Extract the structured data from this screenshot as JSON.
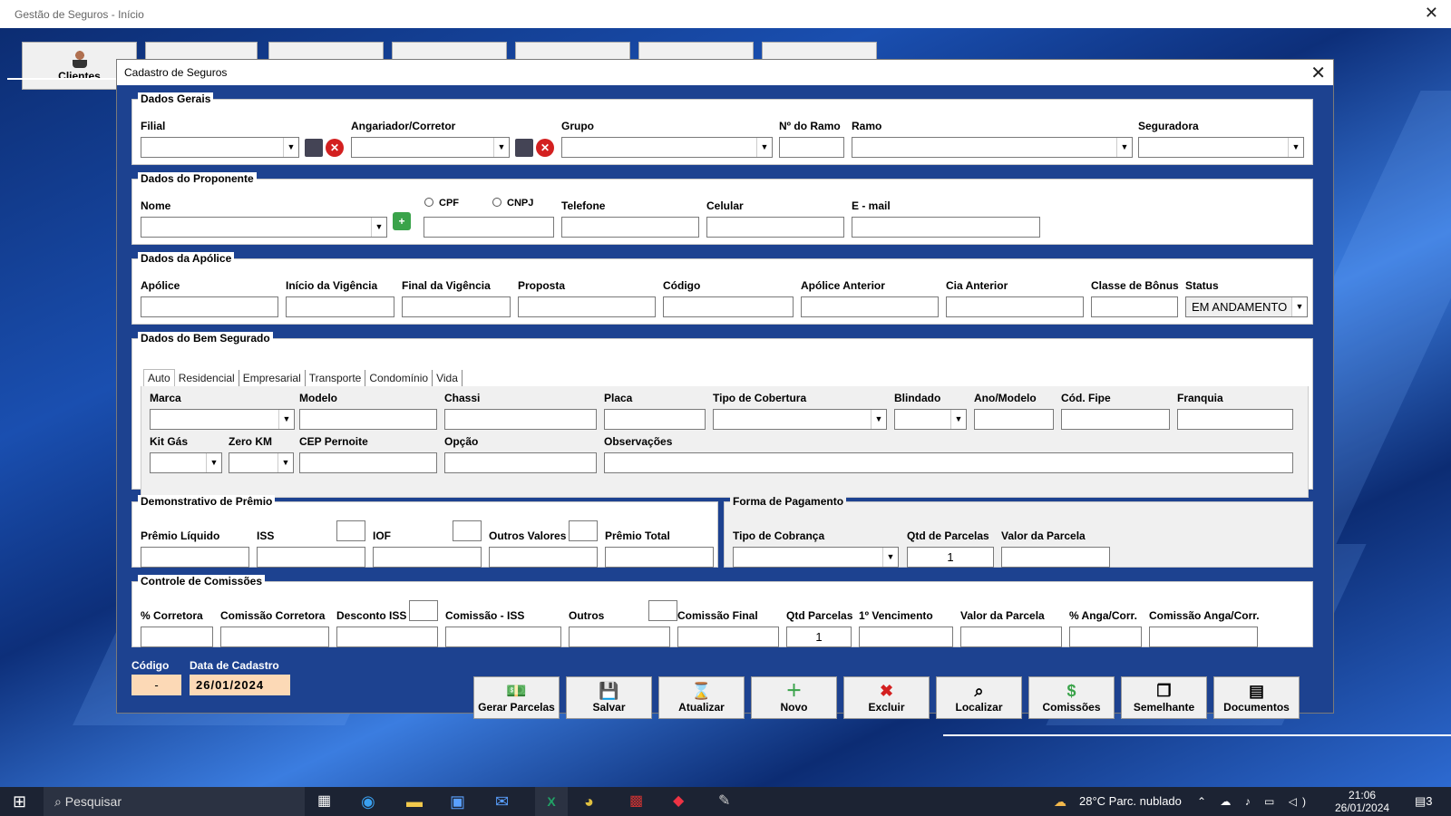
{
  "main": {
    "title": "Gestão de Seguros - Início",
    "clientes_label": "Clientes",
    "close_glyph": "✕"
  },
  "window": {
    "title": "Cadastro de Seguros",
    "close_glyph": "✕"
  },
  "gerais": {
    "legend": "Dados Gerais",
    "filial": "Filial",
    "angariador": "Angariador/Corretor",
    "grupo": "Grupo",
    "nramo": "Nº do Ramo",
    "ramo": "Ramo",
    "seguradora": "Seguradora"
  },
  "proponente": {
    "legend": "Dados do Proponente",
    "nome": "Nome",
    "cpf": "CPF",
    "cnpj": "CNPJ",
    "telefone": "Telefone",
    "celular": "Celular",
    "email": "E - mail"
  },
  "apolice": {
    "legend": "Dados da Apólice",
    "apolice": "Apólice",
    "inicio": "Início da Vigência",
    "final": "Final da Vigência",
    "proposta": "Proposta",
    "codigo": "Código",
    "anterior": "Apólice Anterior",
    "cia": "Cia Anterior",
    "classe": "Classe de Bônus",
    "status": "Status",
    "status_value": "EM ANDAMENTO"
  },
  "bem": {
    "legend": "Dados do Bem Segurado",
    "tabs": [
      "Auto",
      "Residencial",
      "Empresarial",
      "Transporte",
      "Condomínio",
      "Vida"
    ],
    "marca": "Marca",
    "modelo": "Modelo",
    "chassi": "Chassi",
    "placa": "Placa",
    "cobertura": "Tipo de Cobertura",
    "blindado": "Blindado",
    "anomodelo": "Ano/Modelo",
    "fipe": "Cód. Fipe",
    "franquia": "Franquia",
    "kitgas": "Kit Gás",
    "zerokm": "Zero KM",
    "cep": "CEP Pernoite",
    "opcao": "Opção",
    "obs": "Observações"
  },
  "premio": {
    "legend": "Demonstrativo de Prêmio",
    "liquido": "Prêmio Líquido",
    "iss": "ISS",
    "iof": "IOF",
    "outros": "Outros Valores",
    "total": "Prêmio Total"
  },
  "pagamento": {
    "legend": "Forma de Pagamento",
    "cobranca": "Tipo de Cobrança",
    "qtd": "Qtd de Parcelas",
    "qtd_value": "1",
    "valor": "Valor da Parcela"
  },
  "comissoes": {
    "legend": "Controle de Comissões",
    "corretora": "% Corretora",
    "comcorretora": "Comissão Corretora",
    "descontoiss": "Desconto ISS",
    "comiss": "Comissão - ISS",
    "outros": "Outros",
    "final": "Comissão Final",
    "qtd": "Qtd Parcelas",
    "qtd_value": "1",
    "venc": "1º Vencimento",
    "valor": "Valor da Parcela",
    "anga": "% Anga/Corr.",
    "comanga": "Comissão Anga/Corr."
  },
  "footer": {
    "codigo": "Código",
    "codigo_value": "-",
    "data": "Data de Cadastro",
    "data_value": "26/01/2024"
  },
  "buttons": [
    {
      "label": "Gerar Parcelas",
      "icon": "money-icon"
    },
    {
      "label": "Salvar",
      "icon": "floppy-icon"
    },
    {
      "label": "Atualizar",
      "icon": "hourglass-icon"
    },
    {
      "label": "Novo",
      "icon": "new-icon"
    },
    {
      "label": "Excluir",
      "icon": "delete-icon"
    },
    {
      "label": "Localizar",
      "icon": "magnifier-icon"
    },
    {
      "label": "Comissões",
      "icon": "dollar-icon"
    },
    {
      "label": "Semelhante",
      "icon": "copy-icon"
    },
    {
      "label": "Documentos",
      "icon": "documents-icon"
    }
  ],
  "taskbar": {
    "search": "Pesquisar",
    "weather": "28°C  Parc. nublado",
    "time": "21:06",
    "date": "26/01/2024",
    "notif": "3"
  },
  "colors": {
    "accent": "#1d4290",
    "highlight": "#fcd9b6",
    "delete": "#d32020"
  }
}
